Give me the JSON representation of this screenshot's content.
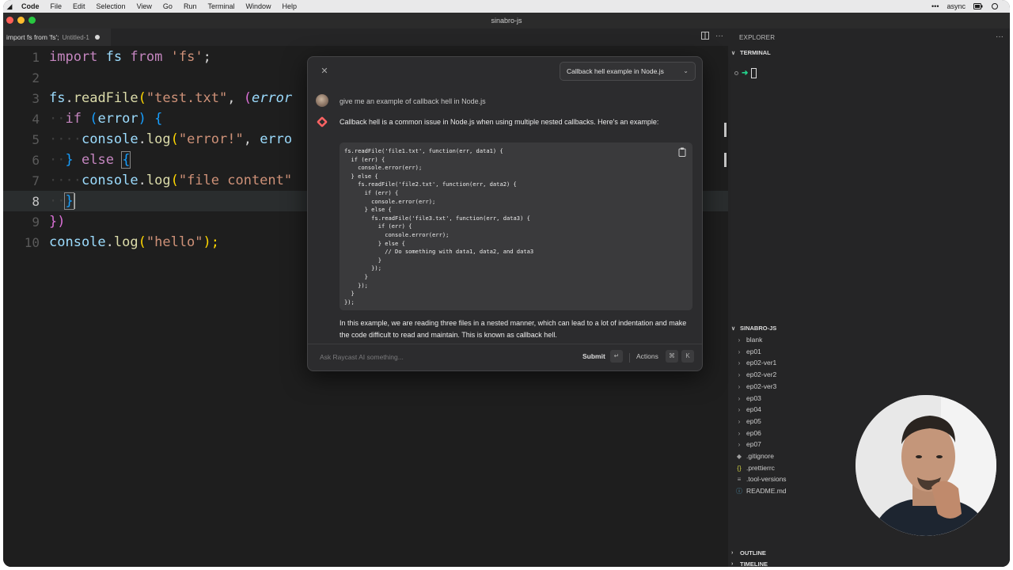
{
  "menubar": {
    "app": "Code",
    "items": [
      "File",
      "Edit",
      "Selection",
      "View",
      "Go",
      "Run",
      "Terminal",
      "Window",
      "Help"
    ],
    "right": {
      "more": "•••",
      "label": "async"
    }
  },
  "window": {
    "title": "sinabro-js"
  },
  "tab": {
    "name": "import fs from 'fs';",
    "file": "Untitled-1"
  },
  "editor": {
    "line_numbers": [
      "1",
      "2",
      "3",
      "4",
      "5",
      "6",
      "7",
      "8",
      "9",
      "10"
    ],
    "line_3": {
      "obj": "fs",
      "dot": ".",
      "fn": "readFile",
      "open": "(",
      "str": "\"test.txt\"",
      "comma": ", ",
      "paren": "(",
      "param": "error"
    },
    "line_4": {
      "kw": "if",
      "open": "(",
      "var": "error",
      "close": ")",
      "brace": "{"
    },
    "line_5": {
      "obj": "console",
      "dot": ".",
      "fn": "log",
      "open": "(",
      "str": "\"error!\"",
      "comma": ", ",
      "var": "erro"
    },
    "line_6": {
      "close": "}",
      "kw": "else",
      "brace": "{"
    },
    "line_7": {
      "obj": "console",
      "dot": ".",
      "fn": "log",
      "open": "(",
      "str": "\"file content\""
    },
    "line_8": {
      "brace": "}"
    },
    "line_9": {
      "close": "})"
    },
    "line_10": {
      "obj": "console",
      "dot": ".",
      "fn": "log",
      "open": "(",
      "str": "\"hello\"",
      "close": ");"
    },
    "line_1": {
      "kw1": "import",
      "name": "fs",
      "kw2": "from",
      "str": "'fs'",
      "end": ";"
    }
  },
  "raycast": {
    "chat_title": "Callback hell example in Node.js",
    "user_message": "give me an example of callback hell in Node.js",
    "ai_intro": "Callback hell is a common issue in Node.js when using multiple nested callbacks. Here's an example:",
    "code": "fs.readFile('file1.txt', function(err, data1) {\n  if (err) {\n    console.error(err);\n  } else {\n    fs.readFile('file2.txt', function(err, data2) {\n      if (err) {\n        console.error(err);\n      } else {\n        fs.readFile('file3.txt', function(err, data3) {\n          if (err) {\n            console.error(err);\n          } else {\n            // Do something with data1, data2, and data3\n          }\n        });\n      }\n    });\n  }\n});",
    "ai_outro": "In this example, we are reading three files in a nested manner, which can lead to a lot of indentation and make the code difficult to read and maintain. This is known as callback hell.",
    "input_placeholder": "Ask Raycast AI something...",
    "submit_label": "Submit",
    "submit_key": "↵",
    "actions_label": "Actions",
    "actions_key1": "⌘",
    "actions_key2": "K"
  },
  "explorer": {
    "title": "EXPLORER",
    "more": "···",
    "terminal_label": "TERMINAL",
    "project_label": "SINABRO-JS",
    "folders": [
      "blank",
      "ep01",
      "ep02-ver1",
      "ep02-ver2",
      "ep02-ver3",
      "ep03",
      "ep04",
      "ep05",
      "ep06",
      "ep07"
    ],
    "files": [
      ".gitignore",
      ".prettierrc",
      ".tool-versions",
      "README.md"
    ],
    "outline_label": "OUTLINE",
    "timeline_label": "TIMELINE"
  },
  "colors": {
    "keyword": "#c586c0",
    "function": "#dcdcaa",
    "variable": "#9cdcfe",
    "string": "#ce9178",
    "terminal_prompt": "#23d18b"
  }
}
